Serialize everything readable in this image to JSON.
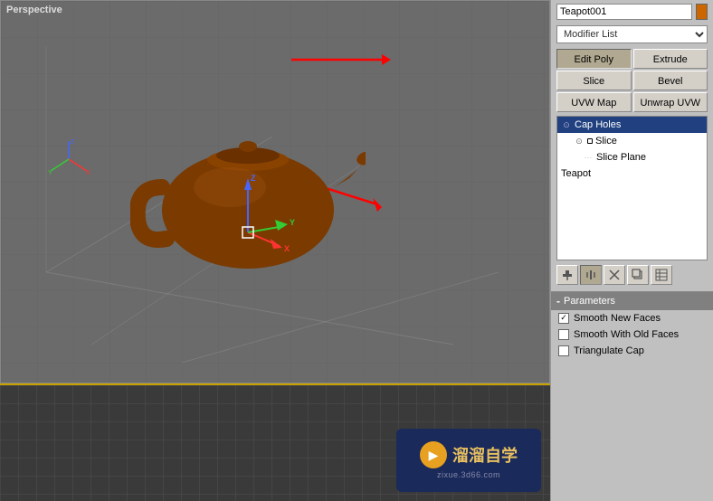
{
  "panel": {
    "name_input": "Teapot001",
    "color_swatch": "#cc6600",
    "modifier_list_placeholder": "Modifier List",
    "buttons": {
      "edit_poly": "Edit Poly",
      "extrude": "Extrude",
      "slice": "Slice",
      "bevel": "Bevel",
      "uvw_map": "UVW Map",
      "unwrap_uvw": "Unwrap UVW"
    },
    "modifier_stack": [
      {
        "id": "cap-holes",
        "label": "Cap Holes",
        "indent": 0,
        "selected": true,
        "has_icon": true
      },
      {
        "id": "slice-parent",
        "label": "Slice",
        "indent": 1,
        "selected": false,
        "has_icon": true
      },
      {
        "id": "slice-plane",
        "label": "Slice Plane",
        "indent": 2,
        "selected": false,
        "has_icon": false
      },
      {
        "id": "teapot",
        "label": "Teapot",
        "indent": 0,
        "selected": false,
        "has_icon": false
      }
    ],
    "stack_actions": [
      "⊳|",
      "I",
      "✂",
      "🔒",
      "⊡"
    ],
    "parameters": {
      "header": "Parameters",
      "items": [
        {
          "id": "smooth-new-faces",
          "label": "Smooth New Faces",
          "checked": true
        },
        {
          "id": "smooth-with-old-faces",
          "label": "Smooth With Old Faces",
          "checked": false
        },
        {
          "id": "triangulate-cap",
          "label": "Triangulate Cap",
          "checked": false
        }
      ]
    }
  },
  "viewport": {
    "label": "Perspective"
  },
  "watermark": {
    "site": "zixue.3d66.com",
    "text": "溜溜自学"
  }
}
